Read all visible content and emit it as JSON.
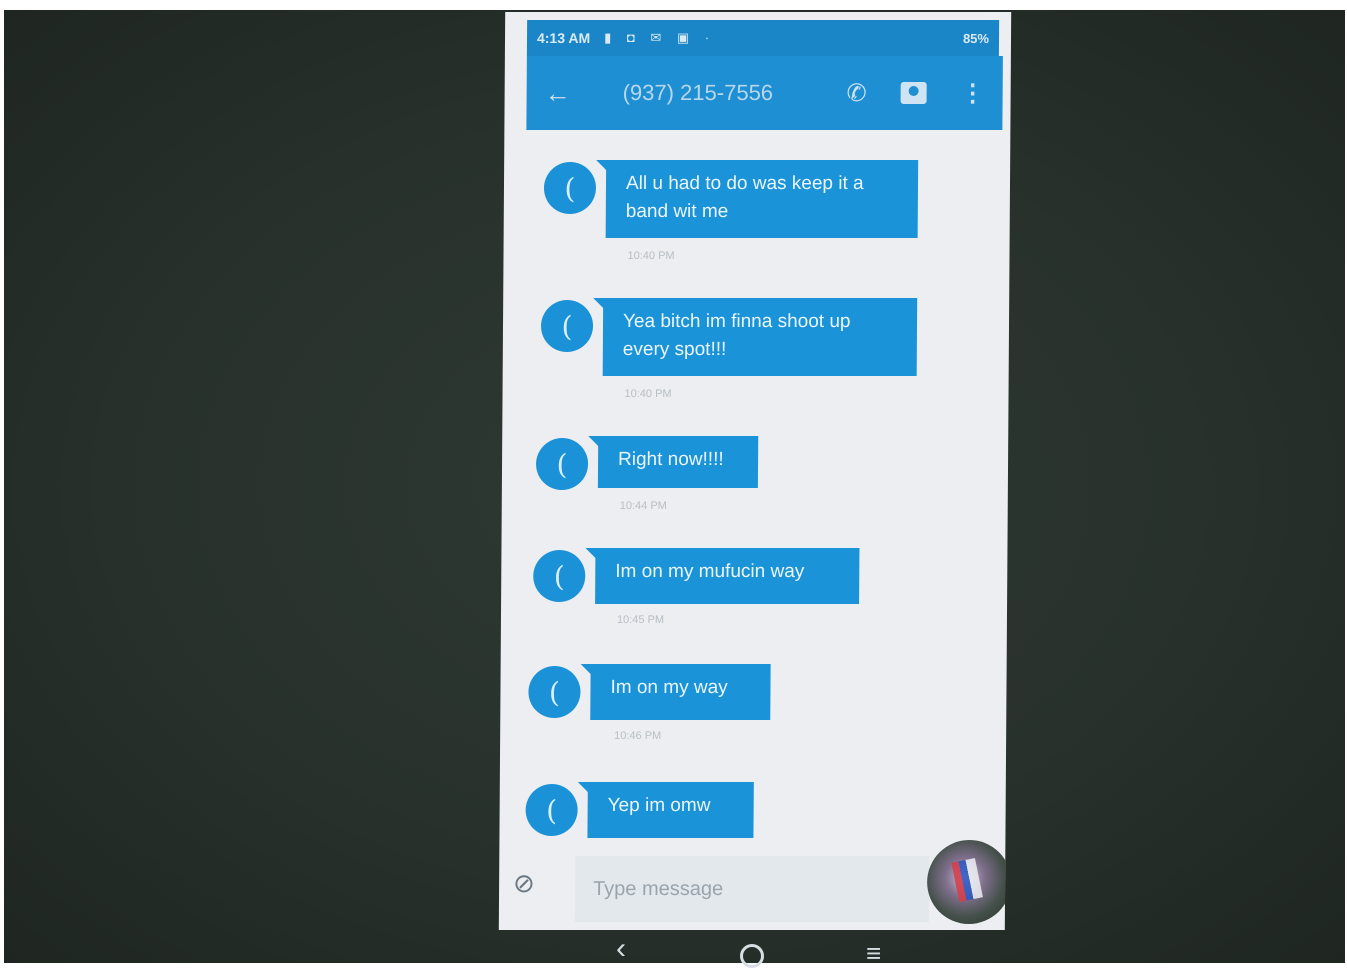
{
  "status_bar": {
    "time": "4:13 AM",
    "icons": [
      "notification-icon",
      "app-icon",
      "gmail-icon",
      "calendar-icon"
    ],
    "battery": "85%"
  },
  "app_bar": {
    "back_icon": "back-arrow-icon",
    "contact": "(937) 215-7556",
    "call_icon": "phone-icon",
    "contact_card_icon": "contact-card-icon",
    "more_icon": "more-vert-icon"
  },
  "messages": [
    {
      "avatar": "(",
      "text": "All u had to do was keep it a band wit me",
      "time": "10:40 PM"
    },
    {
      "avatar": "(",
      "text": "Yea bitch im finna shoot up every spot!!!",
      "time": "10:40 PM"
    },
    {
      "avatar": "(",
      "text": "Right now!!!!",
      "time": "10:44 PM"
    },
    {
      "avatar": "(",
      "text": "Im on my mufucin way",
      "time": "10:45 PM"
    },
    {
      "avatar": "(",
      "text": "Im on my way",
      "time": "10:46 PM"
    },
    {
      "avatar": "(",
      "text": "Yep im omw",
      "time": ""
    }
  ],
  "composer": {
    "attach_icon": "paperclip-icon",
    "placeholder": "Type message"
  },
  "nav_bar": {
    "back": "‹",
    "recent": "≡"
  },
  "colors": {
    "app_bar": "#1e8fd3",
    "bubble": "#1b93d8",
    "background": "#eceef1",
    "photo_surround": "#2b342f"
  }
}
